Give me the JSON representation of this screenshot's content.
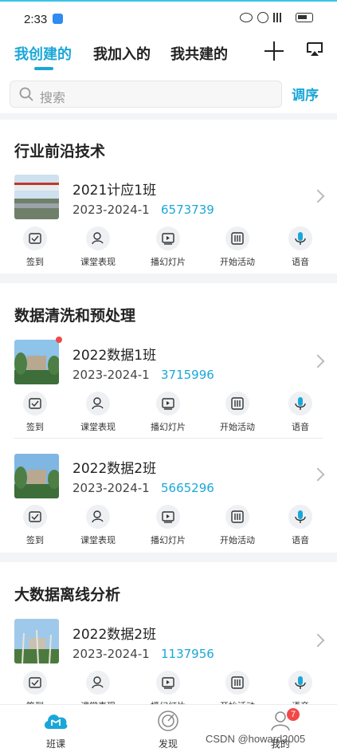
{
  "status_bar": {
    "time": "2:33"
  },
  "tabs": [
    {
      "label": "我创建的",
      "active": true
    },
    {
      "label": "我加入的",
      "active": false
    },
    {
      "label": "我共建的",
      "active": false
    }
  ],
  "search": {
    "placeholder": "搜索"
  },
  "sort_label": "调序",
  "action_labels": [
    "签到",
    "课堂表现",
    "播幻灯片",
    "开始活动",
    "语音"
  ],
  "sections": [
    {
      "title": "行业前沿技术",
      "courses": [
        {
          "name": "2021计应1班",
          "term": "2023-2024-1",
          "code": "6573739",
          "has_dot": false
        }
      ]
    },
    {
      "title": "数据清洗和预处理",
      "courses": [
        {
          "name": "2022数据1班",
          "term": "2023-2024-1",
          "code": "3715996",
          "has_dot": true
        },
        {
          "name": "2022数据2班",
          "term": "2023-2024-1",
          "code": "5665296",
          "has_dot": false
        }
      ]
    },
    {
      "title": "大数据离线分析",
      "courses": [
        {
          "name": "2022数据2班",
          "term": "2023-2024-1",
          "code": "1137956",
          "has_dot": false
        }
      ]
    }
  ],
  "bottom_nav": [
    {
      "label": "班课",
      "active": true
    },
    {
      "label": "发现",
      "active": false
    },
    {
      "label": "我的",
      "active": false,
      "badge": "7"
    }
  ],
  "watermark": "CSDN @howard2005",
  "colors": {
    "accent": "#1aa7d8",
    "badge": "#f24848",
    "voice_icon": "#1aa7d8"
  }
}
